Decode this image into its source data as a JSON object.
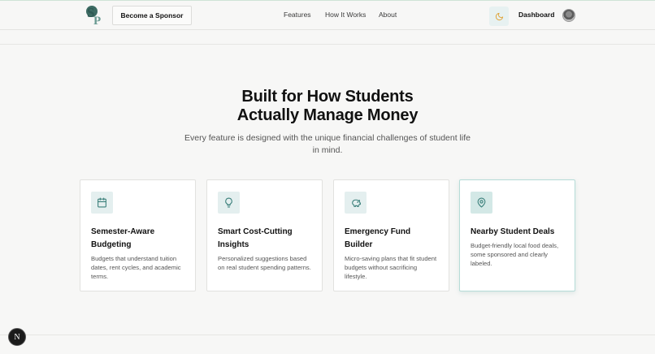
{
  "header": {
    "logo": "logo-icon",
    "sponsor_button": "Become a Sponsor",
    "nav": [
      "Features",
      "How It Works",
      "About"
    ],
    "theme_toggle": "moon-icon",
    "dashboard": "Dashboard",
    "avatar": "avatar"
  },
  "hero": {
    "heading_line1": "Built for How Students",
    "heading_line2": "Actually Manage Money",
    "subtitle_line1": "Every feature is designed with the unique financial challenges of student life",
    "subtitle_line2": "in mind."
  },
  "features": [
    {
      "icon": "calendar-icon",
      "title": "Semester-Aware Budgeting",
      "description": "Budgets that understand tuition dates, rent cycles, and academic terms."
    },
    {
      "icon": "lightbulb-icon",
      "title": "Smart Cost-Cutting Insights",
      "description": "Personalized suggestions based on real student spending patterns."
    },
    {
      "icon": "piggy-bank-icon",
      "title": "Emergency Fund Builder",
      "description": "Micro-saving plans that fit student budgets without sacrificing lifestyle."
    },
    {
      "icon": "map-pin-icon",
      "title": "Nearby Student Deals",
      "description": "Budget-friendly local food deals, some sponsored and clearly labeled."
    }
  ],
  "floating_button": "N",
  "colors": {
    "accent": "#3a7f7a",
    "icon_bg": "#e4efef",
    "moon": "#e0a030"
  }
}
